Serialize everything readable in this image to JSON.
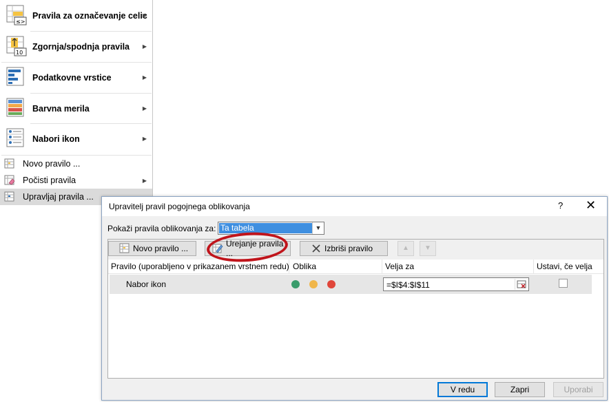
{
  "menu": {
    "items": [
      {
        "label": "Pravila za označevanje celic",
        "icon": "highlight-cells-icon",
        "submenu": true
      },
      {
        "label": "Zgornja/spodnja pravila",
        "icon": "top-bottom-rules-icon",
        "submenu": true
      },
      {
        "label": "Podatkovne vrstice",
        "icon": "data-bars-icon",
        "submenu": true
      },
      {
        "label": "Barvna merila",
        "icon": "color-scales-icon",
        "submenu": true
      },
      {
        "label": "Nabori ikon",
        "icon": "icon-sets-icon",
        "submenu": true
      },
      {
        "label": "Novo pravilo ...",
        "icon": "new-rule-icon",
        "submenu": false
      },
      {
        "label": "Počisti pravila",
        "icon": "clear-rules-icon",
        "submenu": true
      },
      {
        "label": "Upravljaj pravila ...",
        "icon": "manage-rules-icon",
        "submenu": false
      }
    ]
  },
  "dialog": {
    "title": "Upravitelj pravil pogojnega oblikovanja",
    "help": "?",
    "close": "✕",
    "show_label": "Pokaži pravila oblikovanja za:",
    "show_value": "Ta tabela",
    "buttons": {
      "new_rule": "Novo pravilo ...",
      "edit_rule": "Urejanje pravila ...",
      "delete_rule": "Izbriši pravilo"
    },
    "columns": {
      "rule": "Pravilo (uporabljeno v prikazanem vrstnem redu)",
      "format": "Oblika",
      "applies_to": "Velja za",
      "stop_if_true": "Ustavi, če velja"
    },
    "rows": [
      {
        "rule": "Nabor ikon",
        "applies_to": "=$I$4:$I$11",
        "stop_if_true": false,
        "icons_colors": [
          "#3a9c6c",
          "#f0b64a",
          "#e0463a"
        ]
      }
    ],
    "footer": {
      "ok": "V redu",
      "close": "Zapri",
      "apply": "Uporabi"
    }
  },
  "colors": {
    "selection_blue": "#3f8fe0",
    "annotation_red": "#c0141b"
  }
}
